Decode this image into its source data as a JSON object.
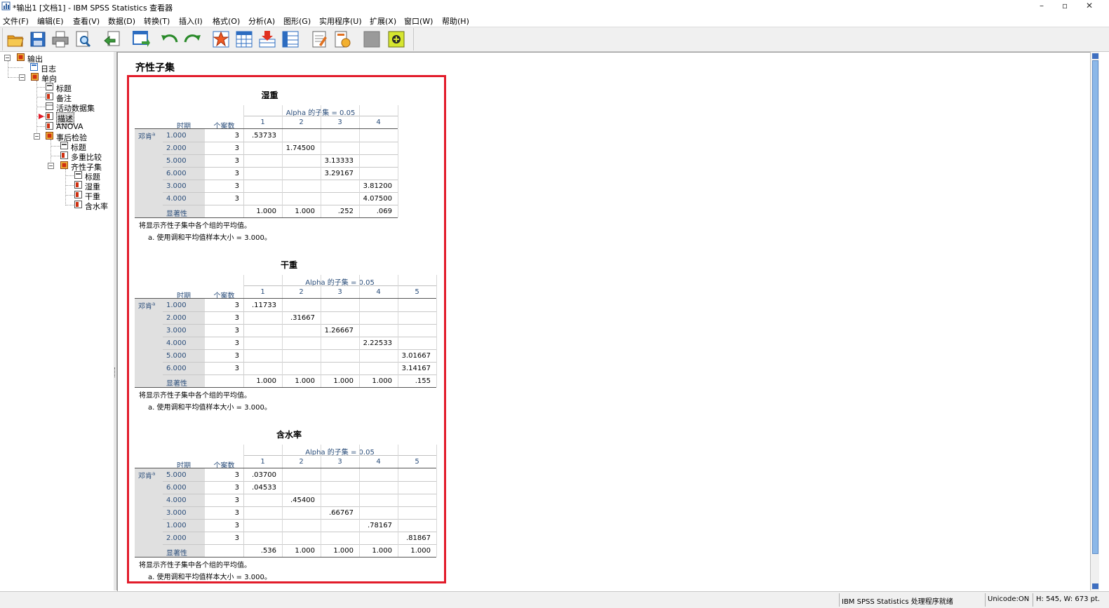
{
  "window": {
    "title": "*输出1 [文档1] - IBM SPSS Statistics 查看器",
    "controls": [
      "–",
      "▫",
      "✕"
    ]
  },
  "menu": [
    "文件(F)",
    "编辑(E)",
    "查看(V)",
    "数据(D)",
    "转换(T)",
    "插入(I)",
    "格式(O)",
    "分析(A)",
    "图形(G)",
    "实用程序(U)",
    "扩展(X)",
    "窗口(W)",
    "帮助(H)"
  ],
  "toolbar_icons": [
    "open-icon",
    "save-icon",
    "print-icon",
    "print-preview-icon",
    "export-icon",
    "goto-data-icon",
    "undo-icon",
    "redo-icon",
    "goto-case-icon",
    "goto-variable-icon",
    "insert-output-icon",
    "variables-icon",
    "text-icon",
    "new-title-icon",
    "disabled-icon",
    "promote-icon"
  ],
  "tree": {
    "nodes": [
      {
        "label": "输出",
        "level": 0
      },
      {
        "label": "日志",
        "level": 1
      },
      {
        "label": "单向",
        "level": 1
      },
      {
        "label": "标题",
        "level": 2
      },
      {
        "label": "备注",
        "level": 2
      },
      {
        "label": "活动数据集",
        "level": 2
      },
      {
        "label": "描述",
        "level": 2
      },
      {
        "label": "ANOVA",
        "level": 2
      },
      {
        "label": "事后检验",
        "level": 2
      },
      {
        "label": "标题",
        "level": 3
      },
      {
        "label": "多重比较",
        "level": 3
      },
      {
        "label": "齐性子集",
        "level": 3
      },
      {
        "label": "标题",
        "level": 4
      },
      {
        "label": "湿重",
        "level": 4
      },
      {
        "label": "干重",
        "level": 4
      },
      {
        "label": "含水率",
        "level": 4
      }
    ]
  },
  "output": {
    "heading": "齐性子集",
    "tables": [
      {
        "title": "湿重",
        "alpha_label": "Alpha 的子集 = 0.05",
        "col_period": "时期",
        "col_n": "个案数",
        "subsets": [
          "1",
          "2",
          "3",
          "4"
        ],
        "method": "邓肯",
        "method_sup": "a",
        "rows": [
          {
            "period": "1.000",
            "n": "3",
            "vals": [
              ".53733",
              "",
              "",
              ""
            ]
          },
          {
            "period": "2.000",
            "n": "3",
            "vals": [
              "",
              "1.74500",
              "",
              ""
            ]
          },
          {
            "period": "5.000",
            "n": "3",
            "vals": [
              "",
              "",
              "3.13333",
              ""
            ]
          },
          {
            "period": "6.000",
            "n": "3",
            "vals": [
              "",
              "",
              "3.29167",
              ""
            ]
          },
          {
            "period": "3.000",
            "n": "3",
            "vals": [
              "",
              "",
              "",
              "3.81200"
            ]
          },
          {
            "period": "4.000",
            "n": "3",
            "vals": [
              "",
              "",
              "",
              "4.07500"
            ]
          }
        ],
        "sig_label": "显著性",
        "sig": [
          "1.000",
          "1.000",
          ".252",
          ".069"
        ],
        "note1": "将显示齐性子集中各个组的平均值。",
        "note2": "a. 使用调和平均值样本大小 = 3.000。"
      },
      {
        "title": "干重",
        "alpha_label": "Alpha 的子集 = 0.05",
        "col_period": "时期",
        "col_n": "个案数",
        "subsets": [
          "1",
          "2",
          "3",
          "4",
          "5"
        ],
        "method": "邓肯",
        "method_sup": "a",
        "rows": [
          {
            "period": "1.000",
            "n": "3",
            "vals": [
              ".11733",
              "",
              "",
              "",
              ""
            ]
          },
          {
            "period": "2.000",
            "n": "3",
            "vals": [
              "",
              ".31667",
              "",
              "",
              ""
            ]
          },
          {
            "period": "3.000",
            "n": "3",
            "vals": [
              "",
              "",
              "1.26667",
              "",
              ""
            ]
          },
          {
            "period": "4.000",
            "n": "3",
            "vals": [
              "",
              "",
              "",
              "2.22533",
              ""
            ]
          },
          {
            "period": "5.000",
            "n": "3",
            "vals": [
              "",
              "",
              "",
              "",
              "3.01667"
            ]
          },
          {
            "period": "6.000",
            "n": "3",
            "vals": [
              "",
              "",
              "",
              "",
              "3.14167"
            ]
          }
        ],
        "sig_label": "显著性",
        "sig": [
          "1.000",
          "1.000",
          "1.000",
          "1.000",
          ".155"
        ],
        "note1": "将显示齐性子集中各个组的平均值。",
        "note2": "a. 使用调和平均值样本大小 = 3.000。"
      },
      {
        "title": "含水率",
        "alpha_label": "Alpha 的子集 = 0.05",
        "col_period": "时期",
        "col_n": "个案数",
        "subsets": [
          "1",
          "2",
          "3",
          "4",
          "5"
        ],
        "method": "邓肯",
        "method_sup": "a",
        "rows": [
          {
            "period": "5.000",
            "n": "3",
            "vals": [
              ".03700",
              "",
              "",
              "",
              ""
            ]
          },
          {
            "period": "6.000",
            "n": "3",
            "vals": [
              ".04533",
              "",
              "",
              "",
              ""
            ]
          },
          {
            "period": "4.000",
            "n": "3",
            "vals": [
              "",
              ".45400",
              "",
              "",
              ""
            ]
          },
          {
            "period": "3.000",
            "n": "3",
            "vals": [
              "",
              "",
              ".66767",
              "",
              ""
            ]
          },
          {
            "period": "1.000",
            "n": "3",
            "vals": [
              "",
              "",
              "",
              ".78167",
              ""
            ]
          },
          {
            "period": "2.000",
            "n": "3",
            "vals": [
              "",
              "",
              "",
              "",
              ".81867"
            ]
          }
        ],
        "sig_label": "显著性",
        "sig": [
          ".536",
          "1.000",
          "1.000",
          "1.000",
          "1.000"
        ],
        "note1": "将显示齐性子集中各个组的平均值。",
        "note2": "a. 使用调和平均值样本大小 = 3.000。"
      }
    ]
  },
  "status": {
    "processor": "IBM SPSS Statistics 处理程序就绪",
    "unicode": "Unicode:ON",
    "size": "H: 545, W: 673 pt."
  },
  "colors": {
    "highlight_box": "#e21c2a",
    "header_text": "#2a4d7a",
    "row_header_bg": "#e0e0e0"
  }
}
